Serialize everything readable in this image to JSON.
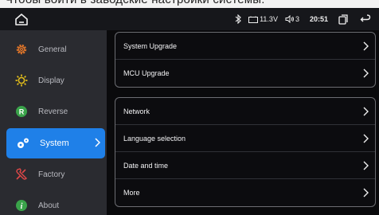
{
  "caption": "Чтобы войти в заводские настройки системы:",
  "status": {
    "voltage": "11.3V",
    "volume": "3",
    "time": "20:51"
  },
  "sidebar": {
    "items": [
      {
        "label": "General",
        "icon": "gear-icon",
        "color": "#e0762a"
      },
      {
        "label": "Display",
        "icon": "brightness-icon",
        "color": "#e8c21a"
      },
      {
        "label": "Reverse",
        "icon": "reverse-r-icon",
        "color": "#3aa34a"
      },
      {
        "label": "System",
        "icon": "system-gears-icon",
        "color": "#ffffff",
        "active": true
      },
      {
        "label": "Factory",
        "icon": "factory-tools-icon",
        "color": "#e04848"
      },
      {
        "label": "About",
        "icon": "info-icon",
        "color": "#3aa34a"
      }
    ]
  },
  "main": {
    "group1": [
      "System Upgrade",
      "MCU Upgrade"
    ],
    "group2": [
      "Network",
      "Language selection",
      "Date and time",
      "More"
    ]
  },
  "colors": {
    "accent": "#1f80e8",
    "sidebar_bg": "#2a2b30",
    "main_bg": "#0a0a0c"
  }
}
